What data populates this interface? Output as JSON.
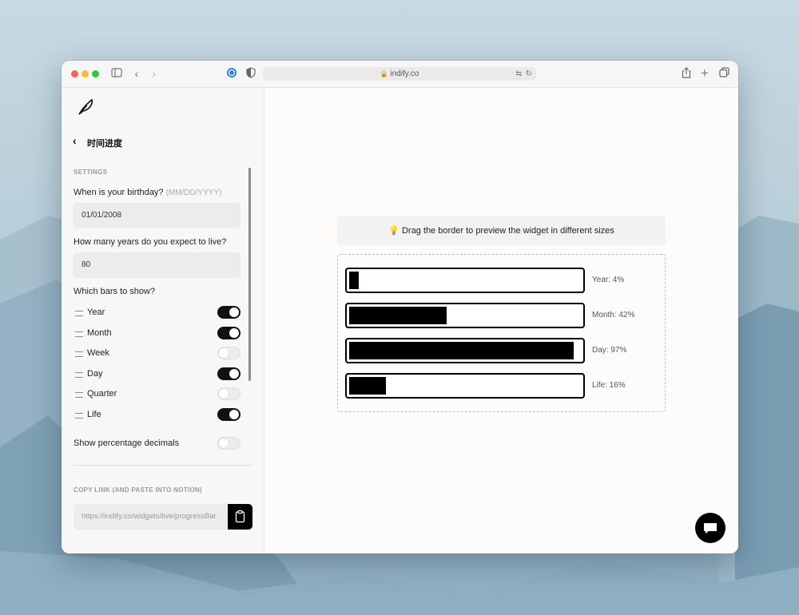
{
  "browser": {
    "url": "indify.co"
  },
  "sidebar": {
    "back_title": "时间进度",
    "settings_heading": "SETTINGS",
    "birthday_label": "When is your birthday?",
    "birthday_hint": "(MM/DD/YYYY)",
    "birthday_value": "01/01/2008",
    "years_label": "How many years do you expect to live?",
    "years_value": "80",
    "bars_label": "Which bars to show?",
    "bars": [
      {
        "label": "Year",
        "on": true
      },
      {
        "label": "Month",
        "on": true
      },
      {
        "label": "Week",
        "on": false
      },
      {
        "label": "Day",
        "on": true
      },
      {
        "label": "Quarter",
        "on": false
      },
      {
        "label": "Life",
        "on": true
      }
    ],
    "decimals_label": "Show percentage decimals",
    "decimals_on": false,
    "copy_heading": "COPY LINK (AND PASTE INTO NOTION)",
    "copy_link": "https://indify.co/widgets/live/progressBar"
  },
  "main": {
    "hint": "💡 Drag the border to preview the widget in different sizes",
    "progress": [
      {
        "label": "Year: 4%",
        "value": 0.04
      },
      {
        "label": "Month: 42%",
        "value": 0.42
      },
      {
        "label": "Day: 97%",
        "value": 0.97
      },
      {
        "label": "Life: 16%",
        "value": 0.16
      }
    ]
  }
}
